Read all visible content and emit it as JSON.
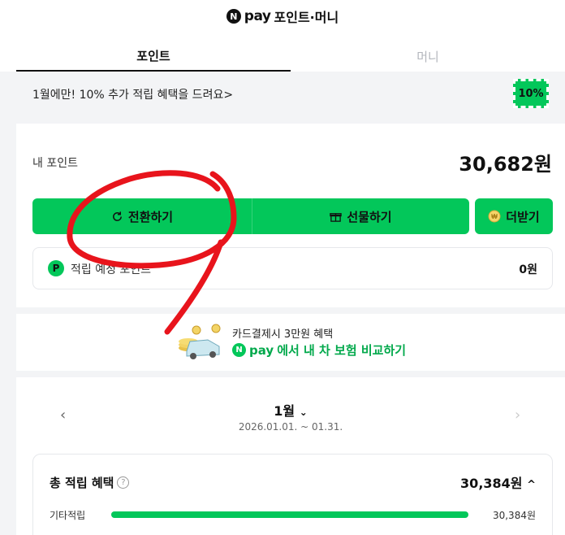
{
  "header": {
    "logo_letter": "N",
    "logo_pay": "pay",
    "title": "포인트·머니",
    "tabs": [
      {
        "label": "포인트",
        "active": true
      },
      {
        "label": "머니",
        "active": false
      }
    ]
  },
  "promo": {
    "text": "1월에만! 10% 추가 적립 혜택을 드려요",
    "chevron": ">",
    "badge": "10%"
  },
  "points": {
    "label": "내 포인트",
    "value": "30,682원",
    "buttons": {
      "convert": "전환하기",
      "gift": "선물하기",
      "more": "더받기"
    },
    "expected": {
      "icon": "P",
      "label": "적립 예정 포인트",
      "value": "0원"
    }
  },
  "ad": {
    "line1": "카드결제시 3만원 혜택",
    "npay_letter": "N",
    "npay_word": "pay",
    "line2": "에서 내 차 보험 비교하기"
  },
  "month": {
    "prev": "‹",
    "next": "›",
    "label": "1월",
    "range": "2026.01.01. ~ 01.31."
  },
  "totals": {
    "label": "총 적립 혜택",
    "help": "?",
    "value": "30,384원",
    "chevron": "^",
    "rows": [
      {
        "label": "기타적립",
        "value": "30,384원",
        "fraction": 1.0
      }
    ]
  },
  "colors": {
    "brand_green": "#03c75a",
    "annotation_red": "#e8141c"
  },
  "icons": [
    "refresh-icon",
    "gift-icon",
    "coin-icon",
    "p-point-icon",
    "help-icon",
    "chevron-left-icon",
    "chevron-right-icon",
    "chevron-down-icon",
    "chevron-up-icon",
    "car-illustration"
  ]
}
